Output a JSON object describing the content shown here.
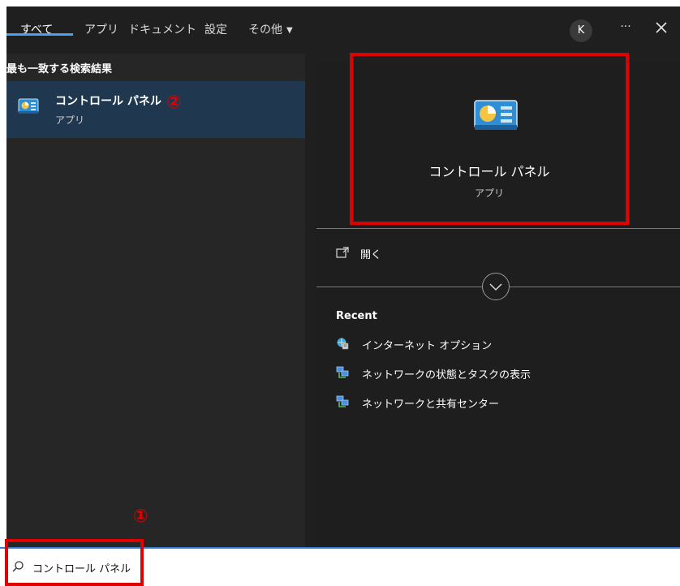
{
  "tabs": [
    {
      "label": "すべて",
      "active": true
    },
    {
      "label": "アプリ"
    },
    {
      "label": "ドキュメント"
    },
    {
      "label": "設定"
    },
    {
      "label": "その他"
    }
  ],
  "header": {
    "avatar_initial": "K",
    "more_label": "···"
  },
  "left_pane": {
    "heading": "最も一致する検索結果",
    "result": {
      "title": "コントロール パネル",
      "subtitle": "アプリ",
      "icon": "control-panel-icon"
    }
  },
  "right_pane": {
    "title": "コントロール パネル",
    "subtitle": "アプリ",
    "icon": "control-panel-icon",
    "open_label": "開く",
    "recent_heading": "Recent",
    "recent_items": [
      {
        "label": "インターネット オプション",
        "icon": "internet-options-icon"
      },
      {
        "label": "ネットワークの状態とタスクの表示",
        "icon": "network-icon"
      },
      {
        "label": "ネットワークと共有センター",
        "icon": "network-icon"
      }
    ]
  },
  "search": {
    "value": "コントロール パネル",
    "icon": "search-icon"
  },
  "annotations": {
    "marker_1": "①",
    "marker_2": "②",
    "highlight_color": "#e00000"
  },
  "colors": {
    "accent": "#4aa0f0",
    "selected_bg": "#20384f",
    "panel_bg": "#1f1f1f"
  }
}
